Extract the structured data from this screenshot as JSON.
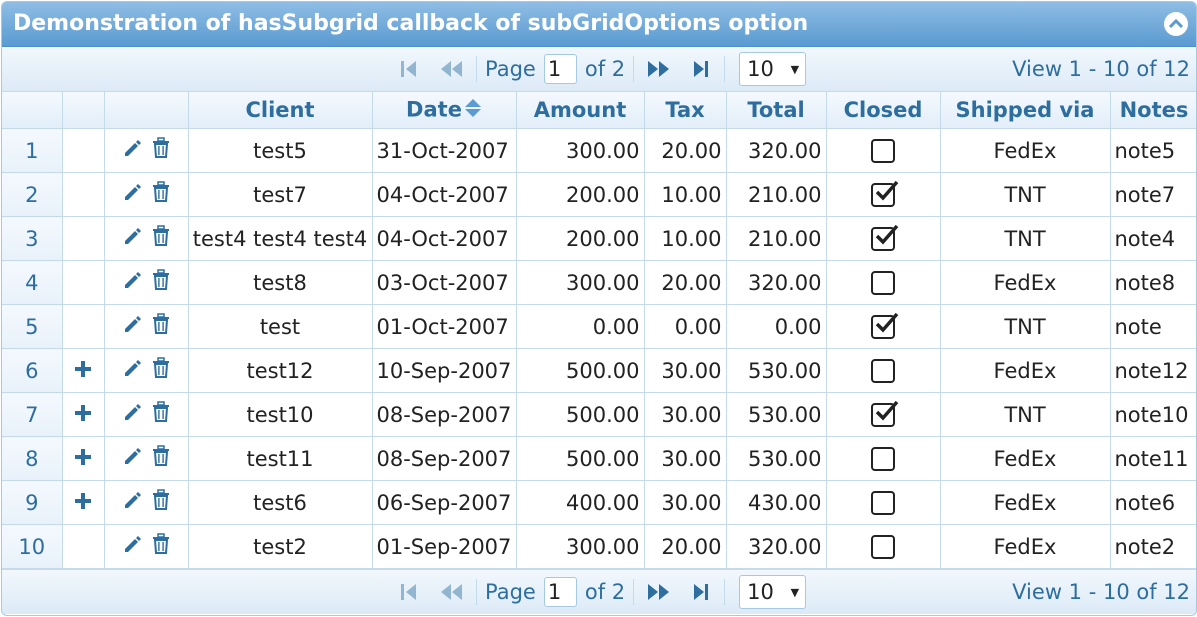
{
  "caption": "Demonstration of hasSubgrid callback of subGridOptions option",
  "pager": {
    "page_label": "Page",
    "page_value": "1",
    "of_label": "of 2",
    "rows_per_page": "10",
    "view_text": "View 1 - 10 of 12"
  },
  "columns": [
    "Client",
    "Date",
    "Amount",
    "Tax",
    "Total",
    "Closed",
    "Shipped via",
    "Notes"
  ],
  "rows": [
    {
      "rn": "1",
      "subgrid": false,
      "client": "test5",
      "date": "31-Oct-2007",
      "amount": "300.00",
      "tax": "20.00",
      "total": "320.00",
      "closed": false,
      "ship": "FedEx",
      "note": "note5"
    },
    {
      "rn": "2",
      "subgrid": false,
      "client": "test7",
      "date": "04-Oct-2007",
      "amount": "200.00",
      "tax": "10.00",
      "total": "210.00",
      "closed": true,
      "ship": "TNT",
      "note": "note7"
    },
    {
      "rn": "3",
      "subgrid": false,
      "client": "test4 test4 test4",
      "date": "04-Oct-2007",
      "amount": "200.00",
      "tax": "10.00",
      "total": "210.00",
      "closed": true,
      "ship": "TNT",
      "note": "note4"
    },
    {
      "rn": "4",
      "subgrid": false,
      "client": "test8",
      "date": "03-Oct-2007",
      "amount": "300.00",
      "tax": "20.00",
      "total": "320.00",
      "closed": false,
      "ship": "FedEx",
      "note": "note8"
    },
    {
      "rn": "5",
      "subgrid": false,
      "client": "test",
      "date": "01-Oct-2007",
      "amount": "0.00",
      "tax": "0.00",
      "total": "0.00",
      "closed": true,
      "ship": "TNT",
      "note": "note"
    },
    {
      "rn": "6",
      "subgrid": true,
      "client": "test12",
      "date": "10-Sep-2007",
      "amount": "500.00",
      "tax": "30.00",
      "total": "530.00",
      "closed": false,
      "ship": "FedEx",
      "note": "note12"
    },
    {
      "rn": "7",
      "subgrid": true,
      "client": "test10",
      "date": "08-Sep-2007",
      "amount": "500.00",
      "tax": "30.00",
      "total": "530.00",
      "closed": true,
      "ship": "TNT",
      "note": "note10"
    },
    {
      "rn": "8",
      "subgrid": true,
      "client": "test11",
      "date": "08-Sep-2007",
      "amount": "500.00",
      "tax": "30.00",
      "total": "530.00",
      "closed": false,
      "ship": "FedEx",
      "note": "note11"
    },
    {
      "rn": "9",
      "subgrid": true,
      "client": "test6",
      "date": "06-Sep-2007",
      "amount": "400.00",
      "tax": "30.00",
      "total": "430.00",
      "closed": false,
      "ship": "FedEx",
      "note": "note6"
    },
    {
      "rn": "10",
      "subgrid": false,
      "client": "test2",
      "date": "01-Sep-2007",
      "amount": "300.00",
      "tax": "20.00",
      "total": "320.00",
      "closed": false,
      "ship": "FedEx",
      "note": "note2"
    }
  ],
  "colors": {
    "header_bg": "#5a9bd1",
    "accent": "#2e6e9e",
    "border": "#c5dbec"
  }
}
